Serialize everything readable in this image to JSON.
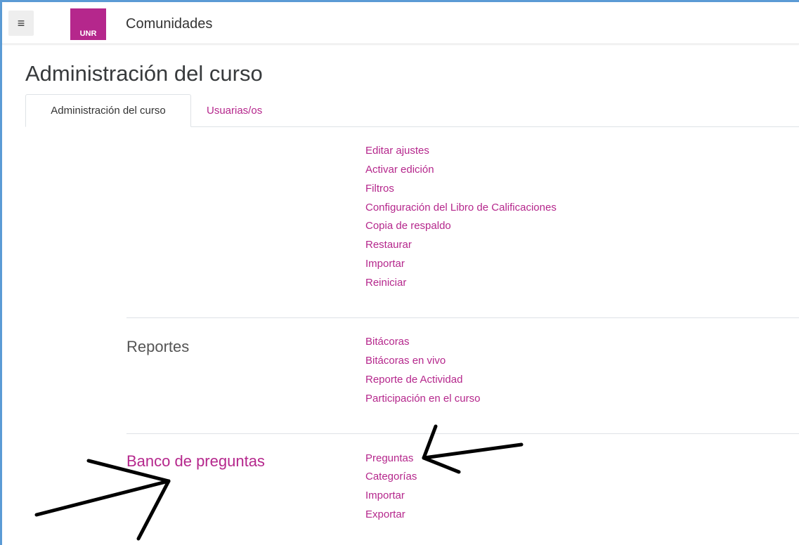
{
  "navbar": {
    "menu_icon": "hamburger-icon",
    "logo_text": "UNR",
    "site_name": "Comunidades"
  },
  "page_title": "Administración del curso",
  "tabs": [
    {
      "label": "Administración del curso",
      "active": true
    },
    {
      "label": "Usuarias/os",
      "active": false
    }
  ],
  "sections": {
    "course": {
      "links": [
        "Editar ajustes",
        "Activar edición",
        "Filtros",
        "Configuración del Libro de Calificaciones",
        "Copia de respaldo",
        "Restaurar",
        "Importar",
        "Reiniciar"
      ]
    },
    "reports": {
      "title": "Reportes",
      "links": [
        "Bitácoras",
        "Bitácoras en vivo",
        "Reporte de Actividad",
        "Participación en el curso"
      ]
    },
    "question_bank": {
      "title": "Banco de preguntas",
      "links": [
        "Preguntas",
        "Categorías",
        "Importar",
        "Exportar"
      ]
    }
  },
  "colors": {
    "brand": "#b5278c",
    "frame": "#5b9bd5"
  }
}
